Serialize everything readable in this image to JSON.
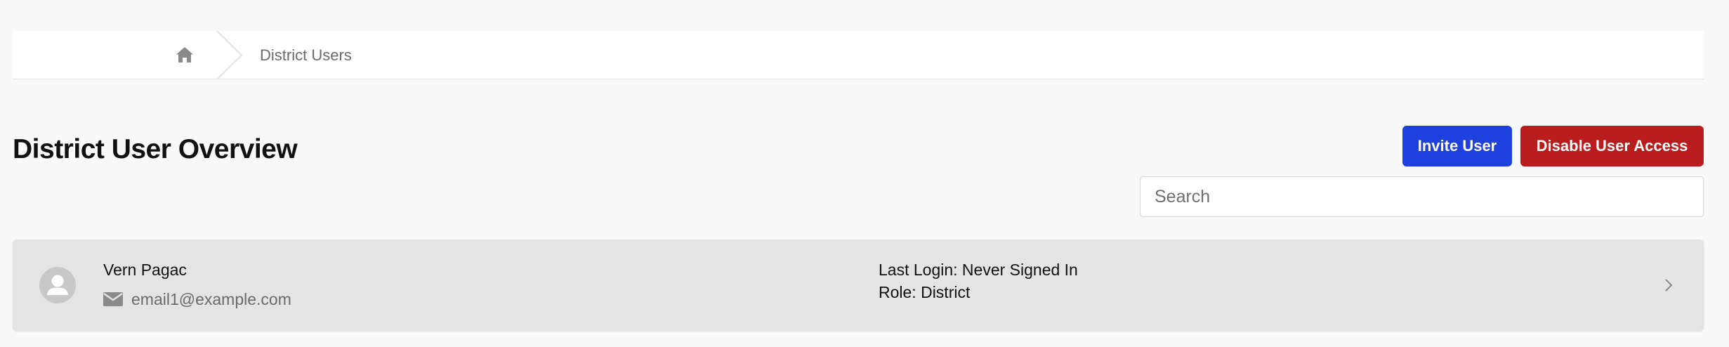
{
  "breadcrumb": {
    "home_icon": "home-icon",
    "current": "District Users"
  },
  "page": {
    "title": "District User Overview"
  },
  "actions": {
    "invite_label": "Invite User",
    "disable_label": "Disable User Access",
    "invite_color": "#1e40df",
    "disable_color": "#b91c1c"
  },
  "search": {
    "placeholder": "Search",
    "value": ""
  },
  "users": [
    {
      "name": "Vern Pagac",
      "email": "email1@example.com",
      "last_login": "Last Login: Never Signed In",
      "role": "Role: District",
      "avatar_icon": "user-avatar-icon",
      "email_icon": "envelope-icon",
      "open_icon": "chevron-right-icon"
    }
  ]
}
